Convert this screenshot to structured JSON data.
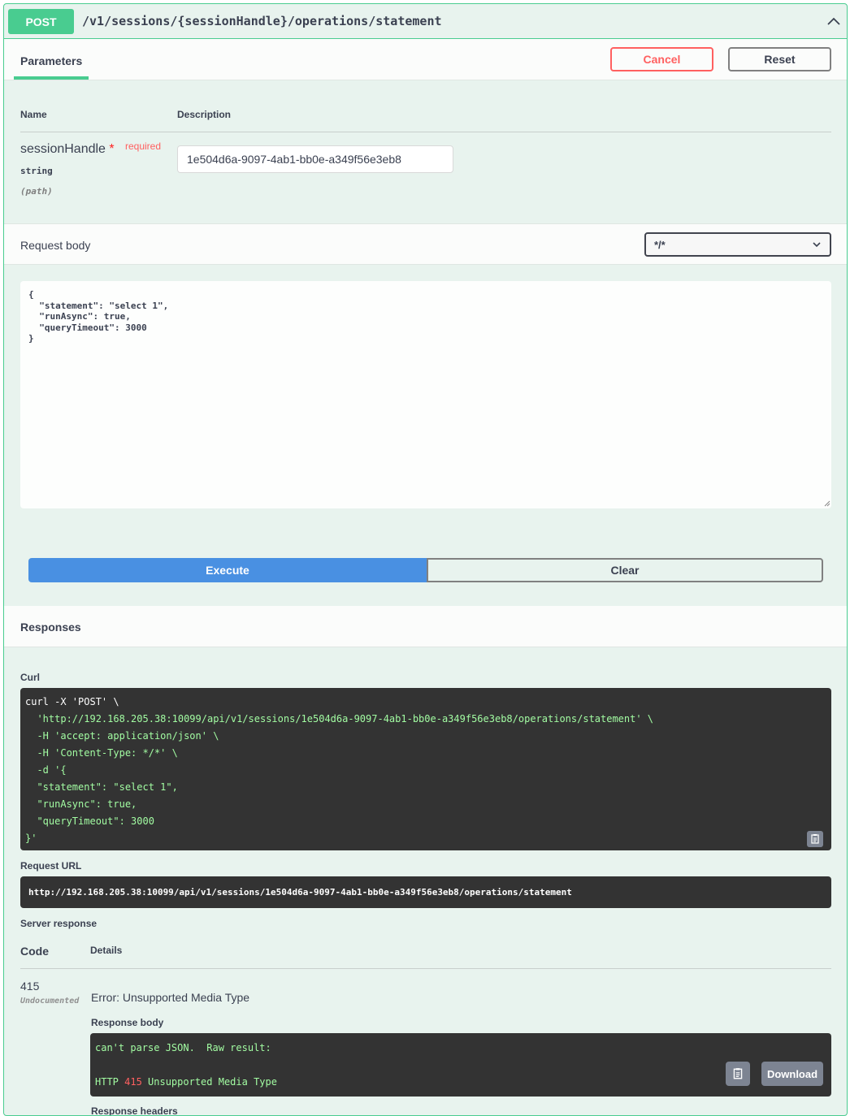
{
  "operation": {
    "method": "POST",
    "path": "/v1/sessions/{sessionHandle}/operations/statement"
  },
  "parameters_header": {
    "tab_label": "Parameters",
    "cancel_label": "Cancel",
    "reset_label": "Reset"
  },
  "parameters_table": {
    "name_header": "Name",
    "description_header": "Description",
    "param": {
      "name": "sessionHandle",
      "required_star": "*",
      "required_label": "required",
      "type": "string",
      "location": "(path)",
      "value": "1e504d6a-9097-4ab1-bb0e-a349f56e3eb8"
    }
  },
  "request_body": {
    "label": "Request body",
    "content_type": "*/*",
    "value": "{\n  \"statement\": \"select 1\",\n  \"runAsync\": true,\n  \"queryTimeout\": 3000\n}"
  },
  "actions": {
    "execute_label": "Execute",
    "clear_label": "Clear"
  },
  "responses": {
    "title": "Responses",
    "curl_label": "Curl",
    "curl_lines": [
      "curl -X 'POST' \\",
      "  'http://192.168.205.38:10099/api/v1/sessions/1e504d6a-9097-4ab1-bb0e-a349f56e3eb8/operations/statement' \\",
      "  -H 'accept: application/json' \\",
      "  -H 'Content-Type: */*' \\",
      "  -d '{",
      "  \"statement\": \"select 1\",",
      "  \"runAsync\": true,",
      "  \"queryTimeout\": 3000",
      "}'"
    ],
    "request_url_label": "Request URL",
    "request_url": "http://192.168.205.38:10099/api/v1/sessions/1e504d6a-9097-4ab1-bb0e-a349f56e3eb8/operations/statement",
    "server_response_label": "Server response",
    "code_header": "Code",
    "details_header": "Details",
    "status_code": "415",
    "status_note": "Undocumented",
    "error_text": "Error: Unsupported Media Type",
    "response_body_label": "Response body",
    "response_body_line1": "can't parse JSON.  Raw result:",
    "response_body_line3": "HTTP 415 Unsupported Media Type",
    "download_label": "Download",
    "response_headers_label": "Response headers"
  },
  "colors": {
    "post_green": "#49cc90",
    "block_bg": "#e8f3ee",
    "execute_blue": "#4990e2",
    "cancel_red": "#ff6060",
    "code_bg": "#333333"
  },
  "icons": [
    "chevron-up-icon",
    "chevron-down-icon",
    "copy-icon",
    "resize-grip-icon"
  ]
}
